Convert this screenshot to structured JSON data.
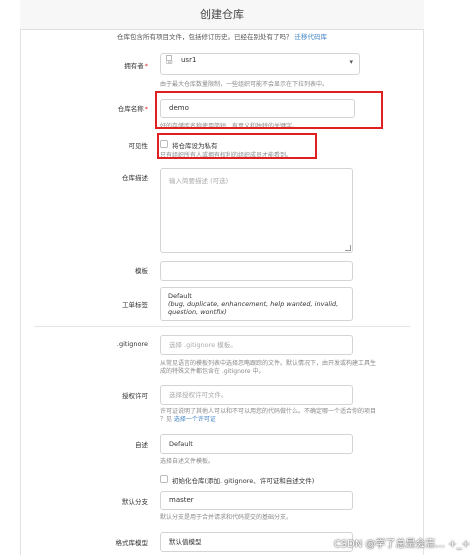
{
  "header": {
    "title": "创建仓库"
  },
  "intro": {
    "text": "仓库包含所有项目文件，包括修订历史。已经在别处有了吗？",
    "link": "迁移代码库"
  },
  "owner": {
    "label": "拥有者",
    "required_mark": "*",
    "avatar_alt": "usr",
    "value": "usr1",
    "help": "由于最大仓库数量限制，一些组织可能不会显示在下拉列表中。"
  },
  "repo_name": {
    "label": "仓库名称",
    "required_mark": "*",
    "value": "demo",
    "help": "好的存储库名称使用简短、有意义和独特的关键字。"
  },
  "visibility": {
    "label": "可见性",
    "checkbox_label": "将仓库设为私有",
    "help": "只有组织所有人或拥有权利的组织成员才能看到。"
  },
  "description": {
    "label": "仓库描述",
    "placeholder": "输入简要描述 (可选)"
  },
  "template": {
    "label": "模板"
  },
  "issue_labels": {
    "label": "工单标签",
    "line1": "Default",
    "line2": "(bug, duplicate, enhancement, help wanted, invalid,",
    "line3": "question, wontfix)"
  },
  "gitignore": {
    "label": ".gitignore",
    "placeholder": "选择 .gitignore 模板。",
    "help1": "从常见语言的模板列表中选择忽略跟踪的文件。默认情况下，由开发或构建工具生",
    "help2": "成的特殊文件都包含在 .gitignore 中。"
  },
  "license": {
    "label": "授权许可",
    "placeholder": "选择授权许可文件。",
    "help1": "许可证说明了其他人可以和不可以用您的代码做什么。不确定哪一个适合你的项目",
    "help2": "？见 ",
    "help_link": "选择一个许可证"
  },
  "readme": {
    "label": "自述",
    "value": "Default",
    "help": "选择自述文件模板。"
  },
  "auto_init": {
    "checkbox_label": "初始化仓库(添加. gitignore、许可证和自述文件)"
  },
  "default_branch": {
    "label": "默认分支",
    "value": "master",
    "help": "默认分支是用于合并请求和代码提交的基础分支。"
  },
  "object_format": {
    "label": "格式库模型",
    "value": "默认值模型"
  },
  "watermark": {
    "text": "CSDN @学了总是会忘... +_+"
  },
  "colors": {
    "highlight": "#e02020",
    "link": "#4183c4",
    "required": "#db2828"
  }
}
